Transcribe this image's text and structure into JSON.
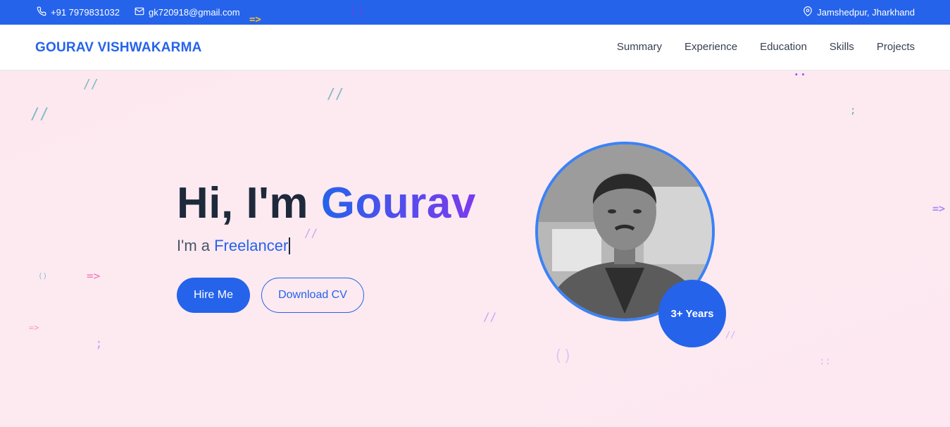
{
  "topbar": {
    "phone": "+91 7979831032",
    "email": "gk720918@gmail.com",
    "location": "Jamshedpur, Jharkhand"
  },
  "navbar": {
    "brand": "GOURAV VISHWAKARMA",
    "links": [
      "Summary",
      "Experience",
      "Education",
      "Skills",
      "Projects"
    ]
  },
  "hero": {
    "greeting": "Hi, I'm ",
    "name": "Gourav",
    "sub_prefix": "I'm a ",
    "role": "Freelancer",
    "hire_button": "Hire Me",
    "cv_button": "Download CV",
    "badge": "3+ Years"
  },
  "colors": {
    "accent": "#2563eb",
    "gradient_end": "#7c3aed",
    "hero_bg": "#fce8ef"
  },
  "icons": [
    "phone-icon",
    "mail-icon",
    "location-pin-icon"
  ]
}
